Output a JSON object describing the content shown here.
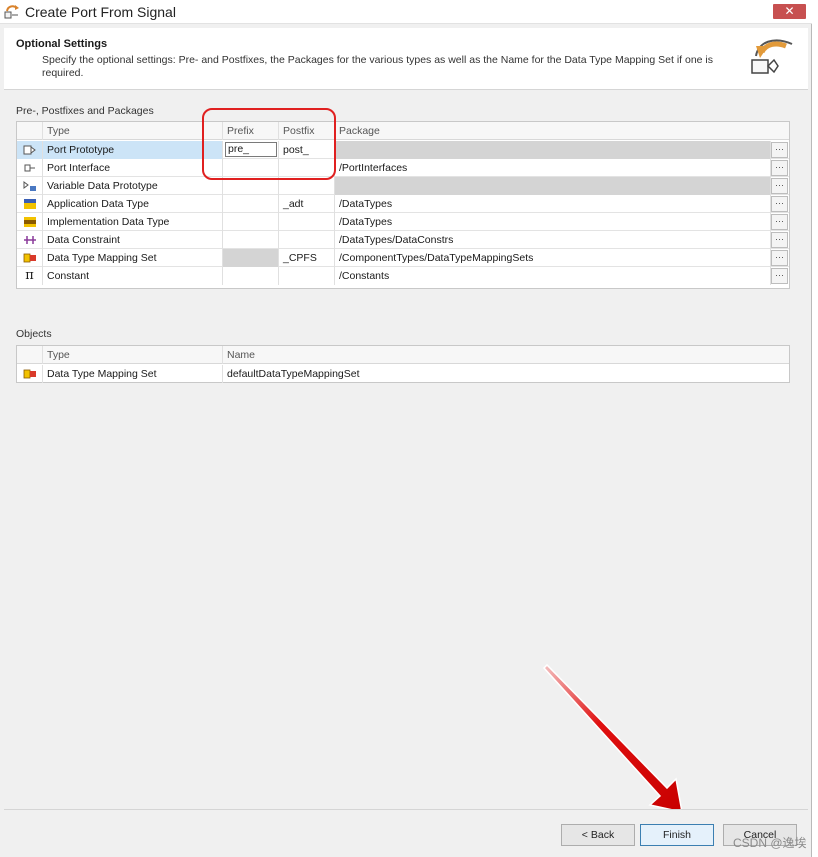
{
  "window": {
    "title": "Create Port From Signal",
    "close_label": "✕"
  },
  "header": {
    "title": "Optional Settings",
    "description": "Specify the optional settings: Pre- and Postfixes, the Packages for the various types as well as the Name for the Data Type Mapping Set if one is required."
  },
  "prefix_section": {
    "label": "Pre-, Postfixes and Packages",
    "columns": {
      "type": "Type",
      "prefix": "Prefix",
      "postfix": "Postfix",
      "package": "Package"
    },
    "rows": [
      {
        "icon": "port-prototype-icon",
        "type": "Port Prototype",
        "prefix": "pre_",
        "postfix": "post_",
        "package": ""
      },
      {
        "icon": "port-interface-icon",
        "type": "Port Interface",
        "prefix": "",
        "postfix": "",
        "package": "/PortInterfaces"
      },
      {
        "icon": "variable-data-prototype-icon",
        "type": "Variable Data Prototype",
        "prefix": "",
        "postfix": "",
        "package": ""
      },
      {
        "icon": "application-data-type-icon",
        "type": "Application Data Type",
        "prefix": "",
        "postfix": "_adt",
        "package": "/DataTypes"
      },
      {
        "icon": "implementation-data-type-icon",
        "type": "Implementation Data Type",
        "prefix": "",
        "postfix": "",
        "package": "/DataTypes"
      },
      {
        "icon": "data-constraint-icon",
        "type": "Data Constraint",
        "prefix": "",
        "postfix": "",
        "package": "/DataTypes/DataConstrs"
      },
      {
        "icon": "data-type-mapping-set-icon",
        "type": "Data Type Mapping Set",
        "prefix": "",
        "postfix": "_CPFS",
        "package": "/ComponentTypes/DataTypeMappingSets"
      },
      {
        "icon": "constant-icon",
        "type": "Constant",
        "prefix": "",
        "postfix": "",
        "package": "/Constants"
      }
    ],
    "ellipsis": "···"
  },
  "objects_section": {
    "label": "Objects",
    "columns": {
      "type": "Type",
      "name": "Name"
    },
    "rows": [
      {
        "icon": "data-type-mapping-set-icon",
        "type": "Data Type Mapping Set",
        "name": "defaultDataTypeMappingSet"
      }
    ]
  },
  "footer": {
    "back_label": "< Back",
    "finish_label": "Finish",
    "cancel_label": "Cancel"
  },
  "watermark": "CSDN @逸埃",
  "colors": {
    "selection": "#cce4f7",
    "callout": "#e02020",
    "arrow": "#e01010",
    "close": "#c75050"
  },
  "constant_glyph": "π"
}
